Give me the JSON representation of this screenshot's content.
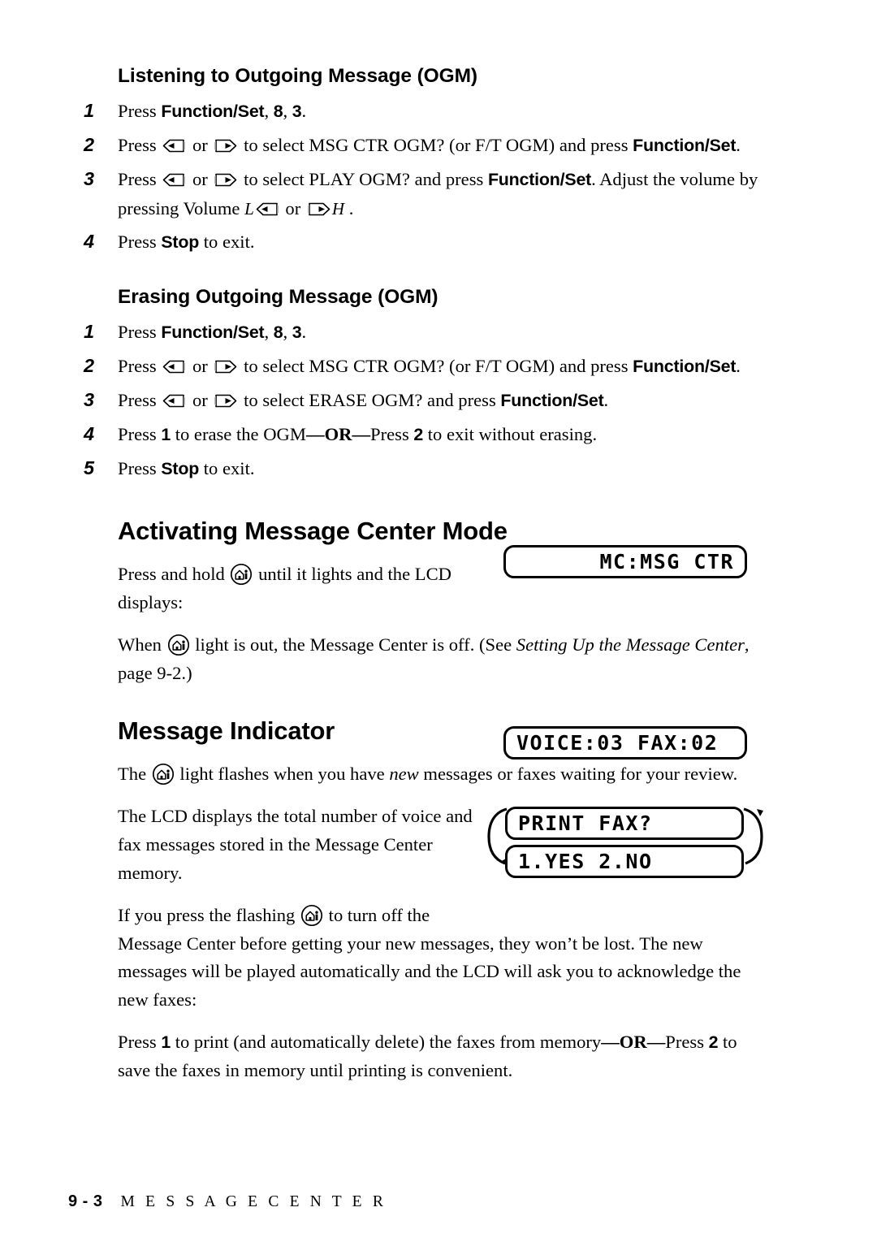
{
  "document": {
    "page_label": "9 - 3",
    "chapter_label": "M E S S A G E   C E N T E R"
  },
  "sections": [
    {
      "id": "listening-ogm",
      "heading": "Listening to Outgoing Message (OGM)",
      "steps": [
        {
          "num": "1",
          "text_parts": [
            "Press ",
            "Function/Set",
            ", ",
            "8",
            ", ",
            "3",
            "."
          ]
        },
        {
          "num": "2",
          "text_parts": [
            "Press ",
            "left-arrow-key",
            " or ",
            "right-arrow-key",
            " to select MSG CTR OGM? (or F/T OGM) and press ",
            "Function/Set",
            "."
          ]
        },
        {
          "num": "3",
          "text_parts": [
            "Press ",
            "left-arrow-key",
            " or ",
            "right-arrow-key",
            " to select PLAY OGM? and press ",
            "Function/Set",
            ". Adjust the volume by pressing Volume ",
            "L-left-arrow-key",
            " or ",
            "right-arrow-key-H",
            "."
          ]
        },
        {
          "num": "4",
          "text_parts": [
            "Press ",
            "Stop",
            " to exit."
          ]
        }
      ]
    },
    {
      "id": "erasing-ogm",
      "heading": "Erasing Outgoing Message (OGM)",
      "steps": [
        {
          "num": "1",
          "text_parts": [
            "Press ",
            "Function/Set",
            ", ",
            "8",
            ", ",
            "3",
            "."
          ]
        },
        {
          "num": "2",
          "text_parts": [
            "Press ",
            "left-arrow-key",
            " or ",
            "right-arrow-key",
            " to select MSG CTR OGM? (or F/T OGM) and press ",
            "Function/Set",
            "."
          ]
        },
        {
          "num": "3",
          "text_parts": [
            "Press ",
            "left-arrow-key",
            " or ",
            "right-arrow-key",
            " to select ERASE OGM? and press ",
            "Function/Set",
            "."
          ]
        },
        {
          "num": "4",
          "text_parts": [
            "Press ",
            "1",
            " to erase the OGM",
            "—OR—",
            "Press ",
            "2",
            " to exit without erasing."
          ]
        },
        {
          "num": "5",
          "text_parts": [
            "Press ",
            "Stop",
            " to exit."
          ]
        }
      ]
    }
  ],
  "step_text": {
    "s1_press": "Press ",
    "s1_fs": "Function/Set",
    "s1_comma": ", ",
    "s1_eight": "8",
    "s1_comma2": ", ",
    "s1_three": "3",
    "s1_period": ".",
    "s2_press": "Press ",
    "s2_or": " or ",
    "s2_mid": " to select MSG CTR OGM? (or F/T OGM) and press ",
    "s2_fs": "Function/Set",
    "s2_period": ".",
    "s3l_mid": " to select PLAY OGM? and press ",
    "s3l_fs": "Function/Set",
    "s3l_tail": ". Adjust the volume by pressing Volume ",
    "s3l_vol_l": "L",
    "s3l_vol_or": " or ",
    "s3l_vol_h": "H",
    "s3l_end": " .",
    "s4l_press": "Press ",
    "s4l_stop": "Stop",
    "s4l_exit": " to exit.",
    "s3e_mid": " to select ERASE OGM? and press ",
    "s3e_fs": "Function/Set",
    "s3e_period": ".",
    "s4e_press": "Press ",
    "s4e_one": "1",
    "s4e_mid": " to erase the OGM",
    "s4e_or": "—OR—",
    "s4e_press2": "Press ",
    "s4e_two": "2",
    "s4e_tail": " to exit without erasing.",
    "s5e_press": "Press ",
    "s5e_stop": "Stop",
    "s5e_exit": " to exit."
  },
  "activating": {
    "heading": "Activating Message Center Mode",
    "p1_a": "Press and hold ",
    "p1_b": " until it lights and the LCD displays:",
    "p2_a": "When ",
    "p2_b": " light is out, the Message Center is off. (See ",
    "p2_italic": "Setting Up the Message Center",
    "p2_c": ", page 9-2.)",
    "lcd": "MC:MSG CTR"
  },
  "message_indicator": {
    "heading": "Message Indicator",
    "p1_a": "The ",
    "p1_b": " light flashes when you have ",
    "p1_new": "new",
    "p1_c": " messages or faxes waiting for your review.",
    "p2": "The LCD displays the total number of voice and fax messages stored in the Message Center memory.",
    "lcd_counts": "VOICE:03 FAX:02",
    "p3_a": "If you press the flashing ",
    "p3_b": " to turn off the Message Center before getting your new messages, they won’t be lost. The new messages will be played automatically and the LCD will ask you to acknowledge the new faxes:",
    "lcd_prompt_line1": "PRINT FAX?",
    "lcd_prompt_line2": "1.YES 2.NO",
    "p4_a": "Press ",
    "p4_one": "1",
    "p4_b": " to print (and automatically delete) the faxes from memory",
    "p4_or": "—OR—",
    "p4_c": "Press ",
    "p4_two": "2",
    "p4_d": " to save the faxes in memory until printing is convenient."
  },
  "icons": {
    "left_arrow_key": "left-arrow-key-icon",
    "right_arrow_key": "right-arrow-key-icon",
    "message_center_button": "message-center-button-icon",
    "cycle_arrow": "cycle-arrow-icon"
  },
  "colors": {
    "ink": "#000000",
    "paper": "#ffffff"
  }
}
